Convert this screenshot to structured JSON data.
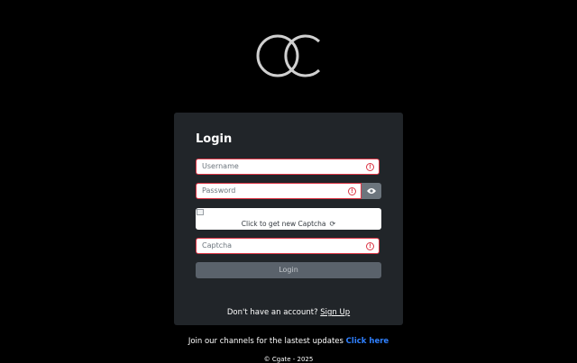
{
  "logo": {
    "icon": "cg-monogram-logo"
  },
  "login_form": {
    "title": "Login",
    "username": {
      "placeholder": "Username",
      "value": ""
    },
    "password": {
      "placeholder": "Password",
      "value": ""
    },
    "captcha_image": {
      "refresh_text": "Click to get new Captcha",
      "refresh_icon": "refresh-icon"
    },
    "captcha": {
      "placeholder": "Captcha",
      "value": ""
    },
    "submit_label": "Login",
    "signup_prompt": "Don't have an account?",
    "signup_link": "Sign Up"
  },
  "footer": {
    "join_text": "Join our channels for the lastest updates",
    "join_link": "Click here",
    "copyright": "© Cgate - 2025"
  },
  "colors": {
    "background": "#000000",
    "card": "#212529",
    "error_border": "#dc3545",
    "button": "#5a626b",
    "link_accent": "#2f80ff"
  }
}
